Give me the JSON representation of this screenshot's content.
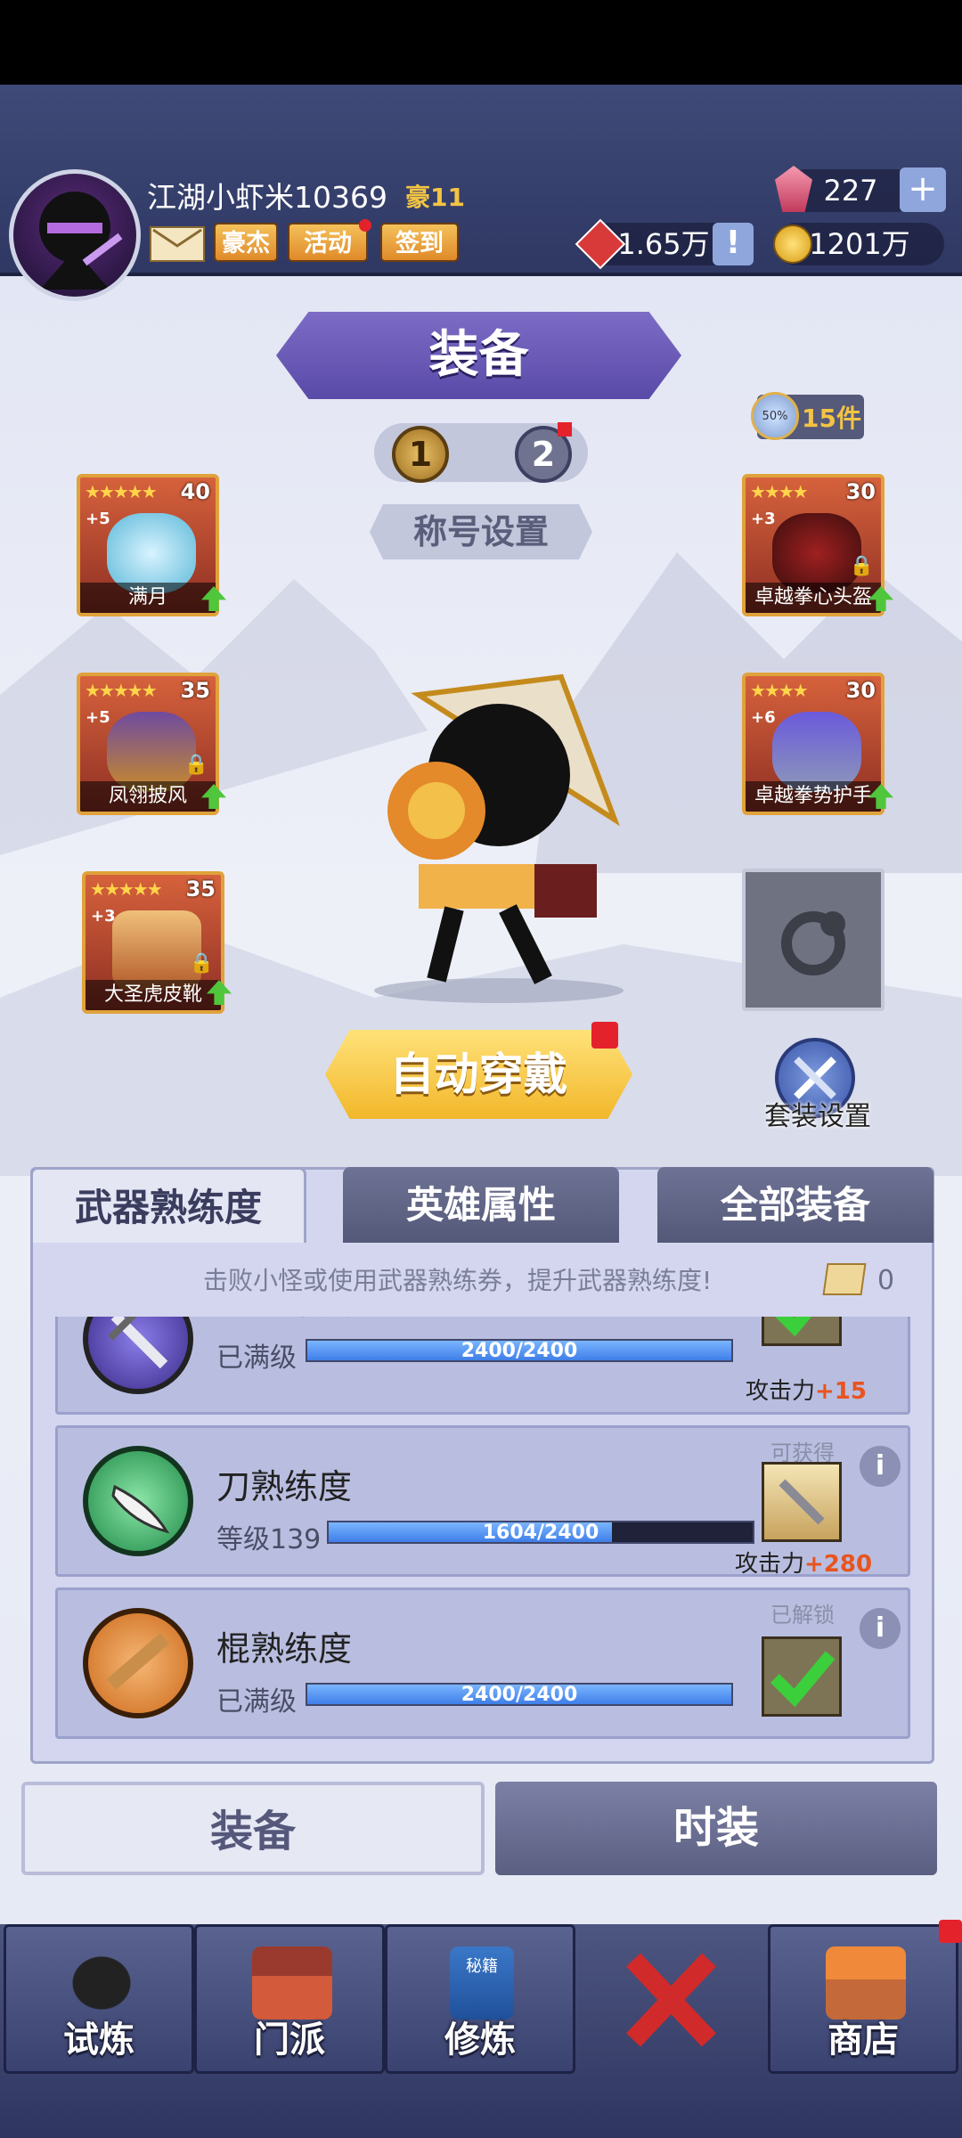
{
  "header": {
    "username": "江湖小虾米10369",
    "vip": "豪11",
    "buttons": {
      "hero": "豪杰",
      "activity": "活动",
      "signin": "签到"
    },
    "gems": "227",
    "honor": "1.65万",
    "gold": "1201万"
  },
  "title": "装备",
  "pages": [
    "1",
    "2"
  ],
  "title_setting": "称号设置",
  "set_count": "15件",
  "set_badge": "50%",
  "slots": {
    "left": [
      {
        "name": "满月",
        "level": "40",
        "plus": "+5",
        "stars": "★★★★★"
      },
      {
        "name": "凤翎披风",
        "level": "35",
        "plus": "+5",
        "stars": "★★★★★"
      },
      {
        "name": "大圣虎皮靴",
        "level": "35",
        "plus": "+3",
        "stars": "★★★★★"
      }
    ],
    "right": [
      {
        "name": "卓越拳心头盔",
        "level": "30",
        "plus": "+3",
        "stars": "★★★★"
      },
      {
        "name": "卓越拳势护手",
        "level": "30",
        "plus": "+6",
        "stars": "★★★★"
      }
    ]
  },
  "auto_wear": "自动穿戴",
  "suit_setting": "套装设置",
  "tabs": [
    "武器熟练度",
    "英雄属性",
    "全部装备"
  ],
  "hint": "击败小怪或使用武器熟练券，提升武器熟练度!",
  "ticket_count": "0",
  "proficiency": [
    {
      "name": "剑熟练度",
      "status": "已满级",
      "progress": "2400/2400",
      "fill": 1.0,
      "bonus_label": "攻击力",
      "bonus": "+15",
      "tag": ""
    },
    {
      "name": "刀熟练度",
      "status": "等级139",
      "progress": "1604/2400",
      "fill": 0.668,
      "bonus_label": "攻击力",
      "bonus": "+280",
      "tag": "可获得"
    },
    {
      "name": "棍熟练度",
      "status": "已满级",
      "progress": "2400/2400",
      "fill": 1.0,
      "bonus_label": "",
      "bonus": "",
      "tag": "已解锁"
    }
  ],
  "bottom_tabs": [
    "装备",
    "时装"
  ],
  "nav": [
    "试炼",
    "门派",
    "修炼",
    "",
    "商店"
  ],
  "nav_book_label": "秘籍",
  "colors": {
    "accent": "#5a4aa8",
    "gold": "#f3c443",
    "bonus": "#e8541f"
  }
}
